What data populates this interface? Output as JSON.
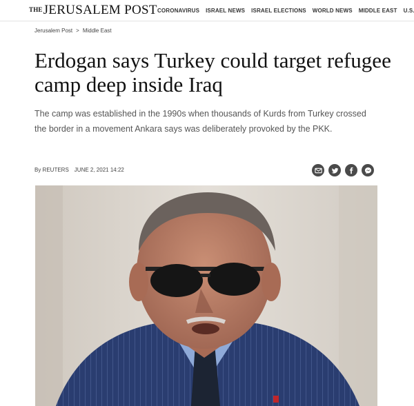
{
  "header": {
    "logo_the": "THE",
    "logo_name": "JERUSALEM POST",
    "nav": [
      "CORONAVIRUS",
      "ISRAEL NEWS",
      "ISRAEL ELECTIONS",
      "WORLD NEWS",
      "MIDDLE EAST",
      "U.S. POLITICS"
    ]
  },
  "breadcrumb": {
    "home": "Jerusalem Post",
    "separator": ">",
    "section": "Middle East"
  },
  "article": {
    "headline": "Erdogan says Turkey could target refugee camp deep inside Iraq",
    "summary": "The camp was established in the 1990s when thousands of Kurds from Turkey crossed the border in a movement Ankara says was deliberately provoked by the PKK.",
    "author": "By REUTERS",
    "date": "JUNE 2, 2021 14:22"
  },
  "share_icons": [
    "email-icon",
    "twitter-icon",
    "facebook-icon",
    "messenger-icon"
  ],
  "colors": {
    "share_button": "#4a4a4a",
    "summary_text": "#555555",
    "headline_text": "#111111"
  }
}
